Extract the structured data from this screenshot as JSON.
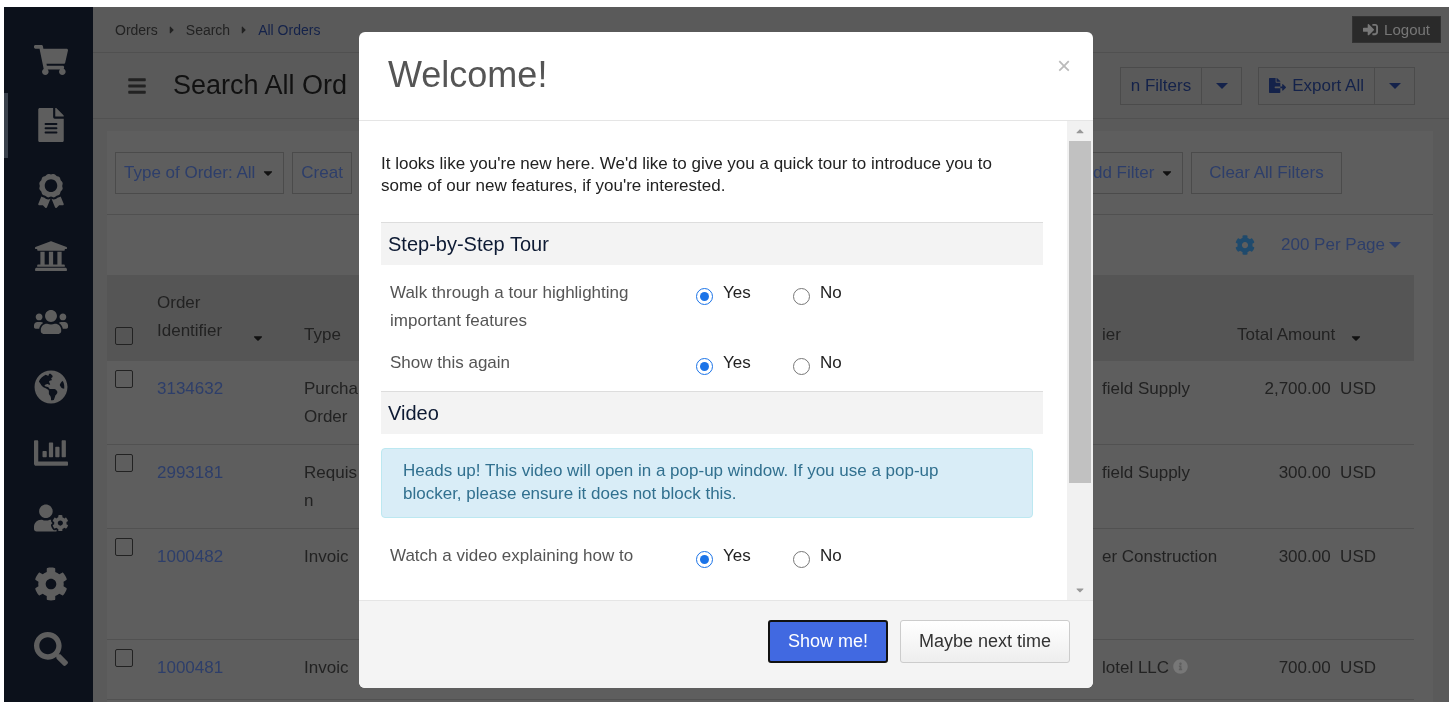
{
  "sidebar": {
    "items": [
      {
        "selected": false
      },
      {
        "selected": true
      },
      {
        "selected": false
      },
      {
        "selected": false
      },
      {
        "selected": false
      },
      {
        "selected": false
      },
      {
        "selected": false
      },
      {
        "selected": false
      },
      {
        "selected": false
      },
      {
        "selected": false
      }
    ]
  },
  "breadcrumb": [
    {
      "label": "Orders",
      "current": false
    },
    {
      "label": "Search",
      "current": false
    },
    {
      "label": "All Orders",
      "current": true
    }
  ],
  "logout": "Logout",
  "page_title": "Search All Ord",
  "header_buttons": [
    {
      "label": "n Filters",
      "kind": "plain"
    },
    {
      "label": "Export All",
      "kind": "export"
    }
  ],
  "filters": [
    "Type of Order: All",
    "Creat",
    "dd Filter"
  ],
  "clear_filters": "Clear All Filters",
  "per_page": "200 Per Page",
  "table": {
    "all_checked": false,
    "columns": [
      "Order Identifier",
      "Type",
      "ier",
      "Total Amount"
    ],
    "rows": [
      {
        "checked": false,
        "id": "3134632",
        "type": "Purcha\nOrder",
        "supplier": "field Supply",
        "info": false,
        "total": "2,700.00  USD"
      },
      {
        "checked": false,
        "id": "2993181",
        "type": "Requis\nn",
        "supplier": "field Supply",
        "info": false,
        "total": "300.00  USD"
      },
      {
        "checked": false,
        "id": "1000482",
        "type": "Invoic",
        "supplier": "er Construction",
        "info": false,
        "total": "300.00  USD"
      },
      {
        "checked": false,
        "id": "1000481",
        "type": "Invoic",
        "supplier": "lotel LLC",
        "info": true,
        "total": "700.00  USD"
      }
    ]
  },
  "modal": {
    "title": "Welcome!",
    "close": "×",
    "intro": "It looks like you're new here. We'd like to give you a quick tour to introduce you to some of our new features, if you're interested.",
    "sections": [
      {
        "title": "Step-by-Step Tour",
        "questions": [
          {
            "label": "Walk through a tour highlighting important features",
            "options": [
              {
                "label": "Yes",
                "selected": true
              },
              {
                "label": "No",
                "selected": false
              }
            ]
          },
          {
            "label": "Show this again",
            "options": [
              {
                "label": "Yes",
                "selected": true
              },
              {
                "label": "No",
                "selected": false
              }
            ]
          }
        ]
      },
      {
        "title": "Video",
        "alert": "Heads up! This video will open in a pop-up window. If you use a pop-up blocker, please ensure it does not block this.",
        "questions": [
          {
            "label": "Watch a video explaining how to",
            "options": [
              {
                "label": "Yes",
                "selected": true
              },
              {
                "label": "No",
                "selected": false
              }
            ]
          }
        ]
      }
    ],
    "buttons": [
      {
        "label": "Show me!",
        "kind": "primary"
      },
      {
        "label": "Maybe next time",
        "kind": "default"
      }
    ]
  }
}
